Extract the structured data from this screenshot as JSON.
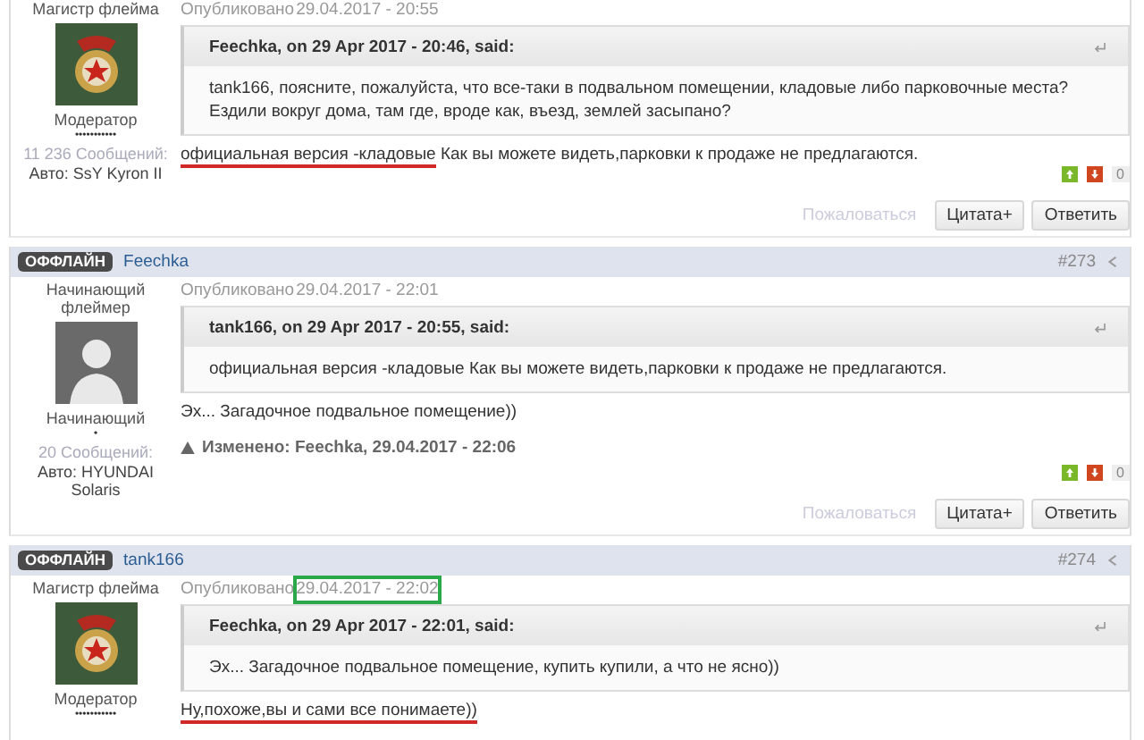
{
  "posts": [
    {
      "rank": "Магистр флейма",
      "avatar": {
        "kind": "badge"
      },
      "group": "Модератор",
      "pips": "•••••••••••",
      "post_count": "11 236 Сообщений:",
      "car": "Авто: SsY Kyron II",
      "published_label": "Опубликовано",
      "date": "29.04.2017 - 20:55",
      "date_boxed": false,
      "quote": {
        "author": "Feechka, on 29 Apr 2017 - 20:46, said:",
        "text": "tank166, поясните, пожалуйста, что все-таки в подвальном помещении, кладовые либо парковочные места? Ездили вокруг дома, там где, вроде как, въезд, землей засыпано?"
      },
      "body": [
        {
          "text": "официальная версия -кладовые",
          "underlined": true
        },
        {
          "text": " Как вы можете видеть,парковки к продаже не предлагаются.",
          "underlined": false
        }
      ],
      "reputation": "0",
      "actions": {
        "report": "Пожаловаться",
        "quote": "Цитата+",
        "reply": "Ответить"
      }
    },
    {
      "header": {
        "status": "ОФФЛАЙН",
        "author": "Feechka",
        "number": "#273"
      },
      "rank": "Начинающий флеймер",
      "avatar": {
        "kind": "silhouette"
      },
      "group": "Начинающий",
      "pips": "•",
      "post_count": "20 Сообщений:",
      "car": "Авто: HYUNDAI Solaris",
      "published_label": "Опубликовано",
      "date": "29.04.2017 - 22:01",
      "date_boxed": false,
      "quote": {
        "author": "tank166, on 29 Apr 2017 - 20:55, said:",
        "text": "официальная версия -кладовые Как вы можете видеть,парковки к продаже не предлагаются."
      },
      "body": [
        {
          "text": "Эх... Загадочное подвальное помещение))",
          "underlined": false
        }
      ],
      "edited": "Изменено: Feechka, 29.04.2017 - 22:06",
      "reputation": "0",
      "actions": {
        "report": "Пожаловаться",
        "quote": "Цитата+",
        "reply": "Ответить"
      }
    },
    {
      "header": {
        "status": "ОФФЛАЙН",
        "author": "tank166",
        "number": "#274"
      },
      "rank": "Магистр флейма",
      "avatar": {
        "kind": "badge"
      },
      "group": "Модератор",
      "pips": "•••••••••••",
      "published_label": "Опубликовано",
      "date": "29.04.2017 - 22:02",
      "date_boxed": true,
      "quote": {
        "author": "Feechka, on 29 Apr 2017 - 22:01, said:",
        "text": "Эх... Загадочное подвальное помещение, купить купили, а что не ясно))"
      },
      "body": [
        {
          "text": "Ну,похоже,вы и сами все понимаете))",
          "underlined": true
        }
      ]
    }
  ]
}
